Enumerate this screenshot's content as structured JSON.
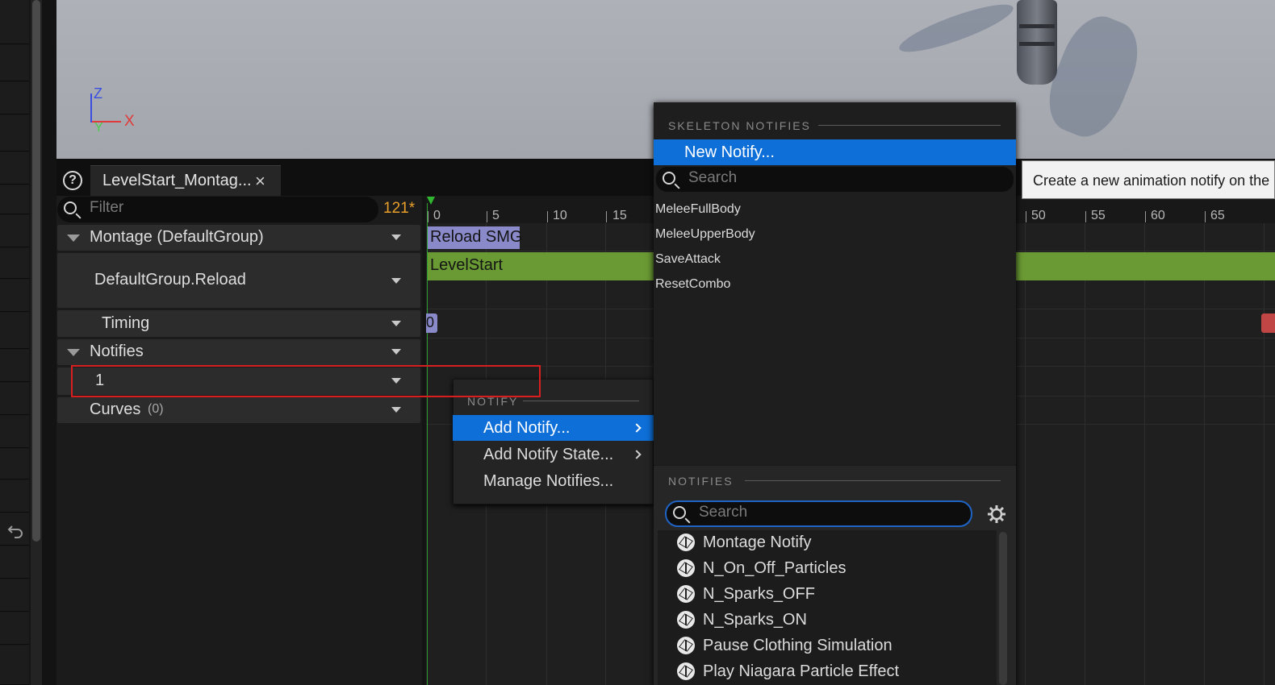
{
  "viewport": {
    "axis_z": "Z",
    "axis_x": "X",
    "axis_y": "Y"
  },
  "tab": {
    "title": "LevelStart_Montag...",
    "close": "×",
    "help": "?"
  },
  "tree": {
    "filter_placeholder": "Filter",
    "frame_count": "121*",
    "rows": {
      "montage": "Montage (DefaultGroup)",
      "slot": "DefaultGroup.Reload",
      "timing": "Timing",
      "notifies": "Notifies",
      "track1": "1",
      "curves": "Curves",
      "curves_count": "(0)"
    }
  },
  "timeline": {
    "ticks_left": [
      "0",
      "5",
      "10",
      "15"
    ],
    "ticks_right": [
      "50",
      "55",
      "60",
      "65"
    ],
    "slot_segment": "Reload SMG",
    "section_segment": "LevelStart",
    "timing_marker": "0"
  },
  "notify_menu": {
    "header": "NOTIFY",
    "items": [
      "Add Notify...",
      "Add Notify State...",
      "Manage Notifies..."
    ]
  },
  "notify_submenu": {
    "skeleton_header": "SKELETON NOTIFIES",
    "new_notify": "New Notify...",
    "search_placeholder": "Search",
    "skeleton_items": [
      "MeleeFullBody",
      "MeleeUpperBody",
      "SaveAttack",
      "ResetCombo"
    ],
    "notifies_header": "NOTIFIES",
    "notifies_search_placeholder": "Search",
    "notify_items": [
      "Montage Notify",
      "N_On_Off_Particles",
      "N_Sparks_OFF",
      "N_Sparks_ON",
      "Pause Clothing Simulation",
      "Play Niagara Particle Effect"
    ]
  },
  "tooltip": {
    "text": "Create a new animation notify on the"
  },
  "colors": {
    "highlight": "#0e6fd8",
    "section_green": "#6a9a34",
    "slot_purple": "#8a8acb",
    "annotation_red": "#d81e1e",
    "frame_orange": "#e9a02a"
  }
}
